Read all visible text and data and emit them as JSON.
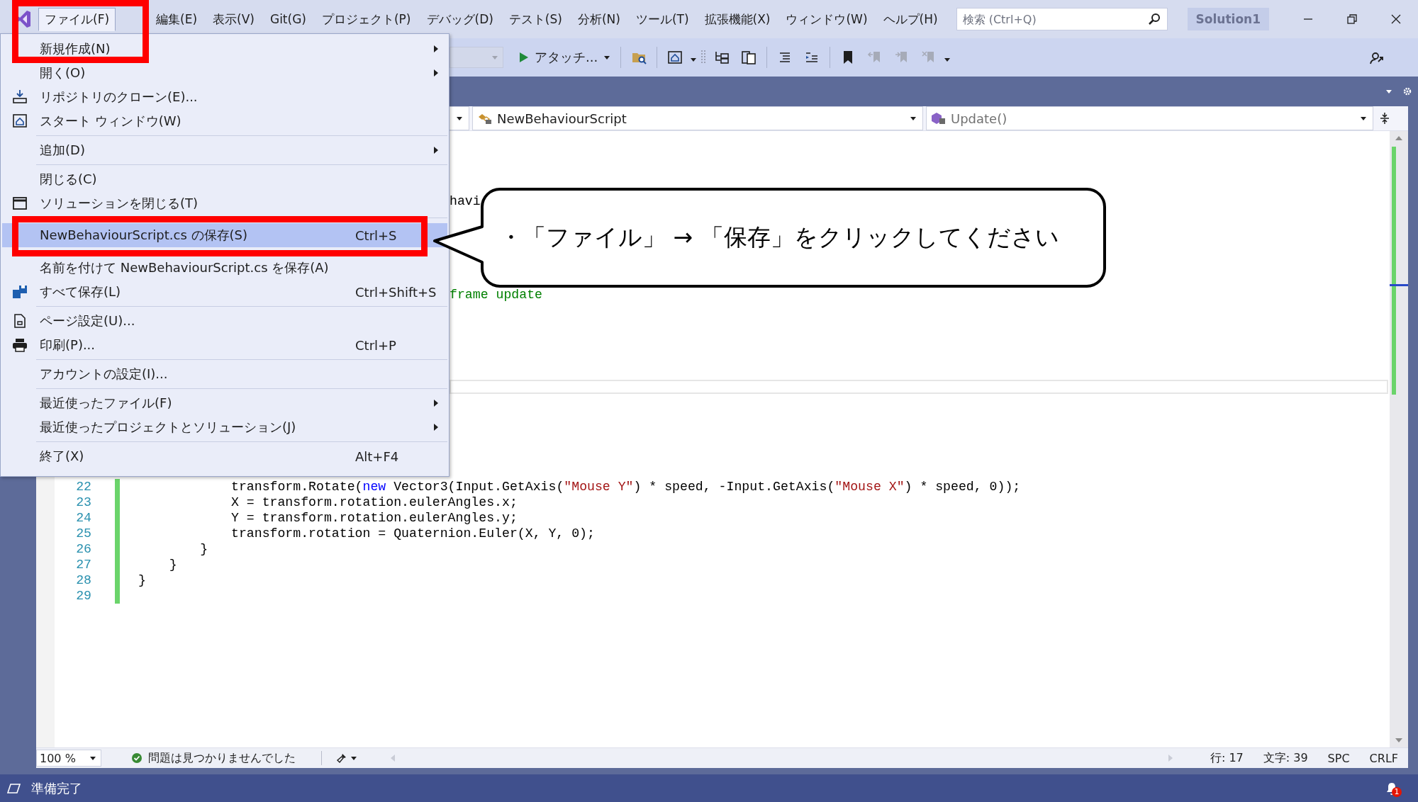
{
  "menu_bar": {
    "items": [
      {
        "label": "ファイル(F)",
        "selected": true
      },
      {
        "label": "編集(E)",
        "selected": false
      },
      {
        "label": "表示(V)",
        "selected": false
      },
      {
        "label": "Git(G)",
        "selected": false
      },
      {
        "label": "プロジェクト(P)",
        "selected": false
      },
      {
        "label": "デバッグ(D)",
        "selected": false
      },
      {
        "label": "テスト(S)",
        "selected": false
      },
      {
        "label": "分析(N)",
        "selected": false
      },
      {
        "label": "ツール(T)",
        "selected": false
      },
      {
        "label": "拡張機能(X)",
        "selected": false
      },
      {
        "label": "ウィンドウ(W)",
        "selected": false
      },
      {
        "label": "ヘルプ(H)",
        "selected": false
      }
    ],
    "search": {
      "placeholder": "検索 (Ctrl+Q)"
    },
    "solution_name": "Solution1"
  },
  "toolbar": {
    "attach_label": "アタッチ..."
  },
  "file_menu": {
    "groups": [
      [
        {
          "label": "新規作成(N)",
          "has_submenu": true,
          "selected": false
        },
        {
          "label": "開く(O)",
          "has_submenu": true,
          "selected": false
        },
        {
          "label": "リポジトリのクローン(E)...",
          "has_submenu": false,
          "selected": false
        },
        {
          "label": "スタート ウィンドウ(W)",
          "has_submenu": false,
          "selected": false
        }
      ],
      [
        {
          "label": "追加(D)",
          "has_submenu": true,
          "selected": false
        }
      ],
      [
        {
          "label": "閉じる(C)",
          "has_submenu": false,
          "selected": false
        },
        {
          "label": "ソリューションを閉じる(T)",
          "has_submenu": false,
          "selected": false
        }
      ],
      [
        {
          "label": "NewBehaviourScript.cs の保存(S)",
          "shortcut": "Ctrl+S",
          "has_submenu": false,
          "selected": true
        },
        {
          "label": "名前を付けて NewBehaviourScript.cs を保存(A)",
          "has_submenu": false,
          "selected": false
        },
        {
          "label": "すべて保存(L)",
          "shortcut": "Ctrl+Shift+S",
          "has_submenu": false,
          "selected": false
        }
      ],
      [
        {
          "label": "ページ設定(U)...",
          "has_submenu": false,
          "selected": false
        },
        {
          "label": "印刷(P)...",
          "shortcut": "Ctrl+P",
          "has_submenu": false,
          "selected": false
        }
      ],
      [
        {
          "label": "アカウントの設定(I)...",
          "has_submenu": false,
          "selected": false
        }
      ],
      [
        {
          "label": "最近使ったファイル(F)",
          "has_submenu": true,
          "selected": false
        },
        {
          "label": "最近使ったプロジェクトとソリューション(J)",
          "has_submenu": true,
          "selected": false
        }
      ],
      [
        {
          "label": "終了(X)",
          "shortcut": "Alt+F4",
          "has_submenu": false,
          "selected": false
        }
      ]
    ]
  },
  "navigation_bar": {
    "class_name": "NewBehaviourScript",
    "member_name": "Update()"
  },
  "editor": {
    "fragments": [
      {
        "text": "havi",
        "kind": "plain"
      },
      {
        "text": "frame update",
        "kind": "comment"
      }
    ],
    "lines": [
      {
        "number": "22",
        "modified": true,
        "tokens": [
          {
            "text": "            transform.Rotate(",
            "kind": "plain"
          },
          {
            "text": "new",
            "kind": "keyword"
          },
          {
            "text": " Vector3(Input.GetAxis(",
            "kind": "plain"
          },
          {
            "text": "\"Mouse Y\"",
            "kind": "string"
          },
          {
            "text": ") * speed, -Input.GetAxis(",
            "kind": "plain"
          },
          {
            "text": "\"Mouse X\"",
            "kind": "string"
          },
          {
            "text": ") * speed, 0));",
            "kind": "plain"
          }
        ]
      },
      {
        "number": "23",
        "modified": true,
        "tokens": [
          {
            "text": "            X = transform.rotation.eulerAngles.x;",
            "kind": "plain"
          }
        ]
      },
      {
        "number": "24",
        "modified": true,
        "tokens": [
          {
            "text": "            Y = transform.rotation.eulerAngles.y;",
            "kind": "plain"
          }
        ]
      },
      {
        "number": "25",
        "modified": true,
        "tokens": [
          {
            "text": "            transform.rotation = Quaternion.Euler(X, Y, 0);",
            "kind": "plain"
          }
        ]
      },
      {
        "number": "26",
        "modified": true,
        "tokens": [
          {
            "text": "        }",
            "kind": "plain"
          }
        ]
      },
      {
        "number": "27",
        "modified": true,
        "tokens": [
          {
            "text": "    }",
            "kind": "plain"
          }
        ]
      },
      {
        "number": "28",
        "modified": true,
        "tokens": [
          {
            "text": "}",
            "kind": "plain"
          }
        ]
      },
      {
        "number": "29",
        "modified": true
      }
    ]
  },
  "editor_status": {
    "zoom": "100 %",
    "issues": "問題は見つかりませんでした",
    "line": "行: 17",
    "column": "文字: 39",
    "indent": "SPC",
    "line_ending": "CRLF"
  },
  "status_bar": {
    "text": "準備完了",
    "notifications": "1"
  },
  "callout": {
    "text": "・「ファイル」 → 「保存」をクリックしてください"
  }
}
